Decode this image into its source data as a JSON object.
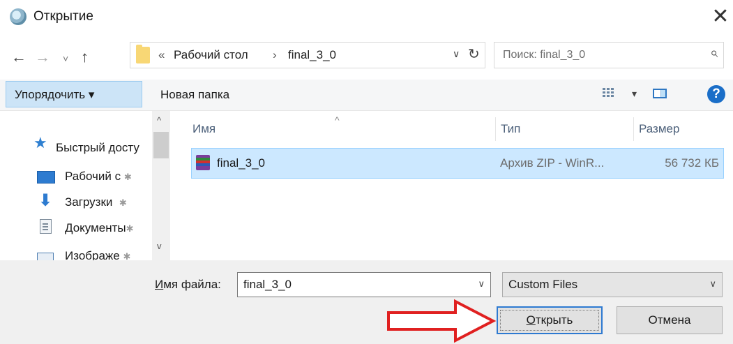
{
  "window": {
    "title": "Открытие",
    "close_glyph": "✕"
  },
  "nav": {
    "back": "←",
    "forward": "→",
    "recent": "˅",
    "up": "↑"
  },
  "address": {
    "prefix": "«",
    "crumbs": [
      "Рабочий стол",
      "final_3_0"
    ],
    "separator": "›",
    "dropdown": "∨",
    "refresh": "↻"
  },
  "search": {
    "placeholder": "Поиск: final_3_0",
    "icon": "⌕"
  },
  "toolbar": {
    "organize_label": "Упорядочить ▾",
    "new_folder_label": "Новая папка",
    "view_dropdown": "▾",
    "help": "?"
  },
  "sidebar": {
    "items": [
      {
        "label": "Быстрый досту",
        "icon": "star-icon",
        "pinned": false
      },
      {
        "label": "Рабочий с",
        "icon": "desktop-icon",
        "pinned": true
      },
      {
        "label": "Загрузки",
        "icon": "download-icon",
        "pinned": true
      },
      {
        "label": "Документы",
        "icon": "documents-icon",
        "pinned": true
      },
      {
        "label": "Изображе",
        "icon": "pictures-icon",
        "pinned": true
      }
    ],
    "pin_glyph": "✱",
    "scroll_up": "^",
    "scroll_down": "v"
  },
  "columns": {
    "name": "Имя",
    "type": "Тип",
    "size": "Размер",
    "sort_indicator": "^"
  },
  "files": [
    {
      "name": "final_3_0",
      "type": "Архив ZIP - WinR...",
      "size": "56 732 КБ",
      "selected": true
    }
  ],
  "footer": {
    "filename_label_underlined": "И",
    "filename_label_rest": "мя файла:",
    "filename_value": "final_3_0",
    "filter_value": "Custom Files",
    "dropdown_glyph": "∨",
    "open_underlined": "О",
    "open_rest": "ткрыть",
    "cancel_label": "Отмена"
  },
  "colors": {
    "accent": "#2e7ad1",
    "selection": "#cce8ff",
    "arrow": "#e02020"
  }
}
